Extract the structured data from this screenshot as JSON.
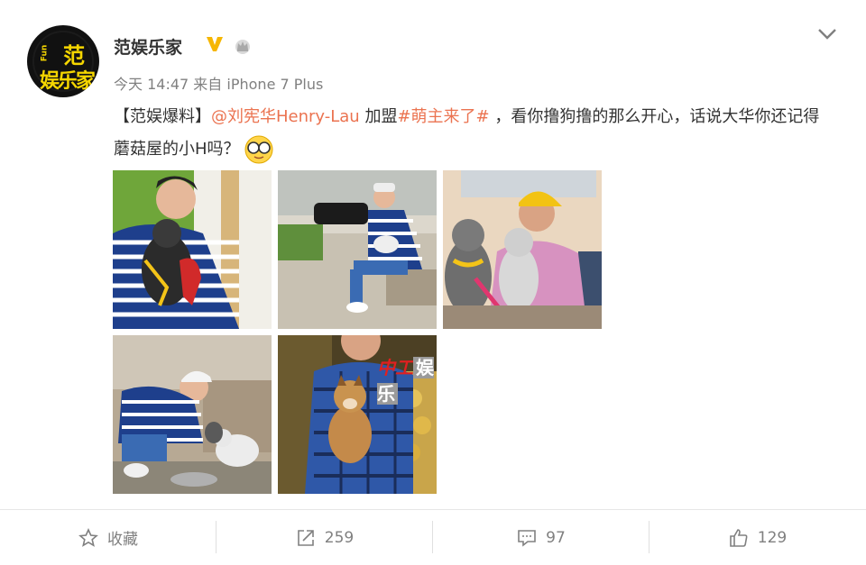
{
  "author": {
    "name": "范娱乐家",
    "avatar_text_main": "范",
    "avatar_text_sub": "娱乐家",
    "avatar_text_side": "Fun"
  },
  "meta": {
    "time": "今天 14:47",
    "source_prefix": "来自",
    "device": "iPhone 7 Plus"
  },
  "post": {
    "tag": "【范娱爆料】",
    "mention": "@刘宪华Henry-Lau",
    "join": " 加盟",
    "topic": "#萌主来了#",
    "body": " ，看你撸狗撸的那么开心，话说大华你还记得蘑菇屋的小H吗？"
  },
  "watermark": {
    "part1": "中工",
    "part2": "娱乐"
  },
  "actions": {
    "favorite": "收藏",
    "repost": "259",
    "comment": "97",
    "like": "129"
  },
  "colors": {
    "link": "#eb7350",
    "muted": "#808080",
    "vip_badge": "#f6b600"
  }
}
